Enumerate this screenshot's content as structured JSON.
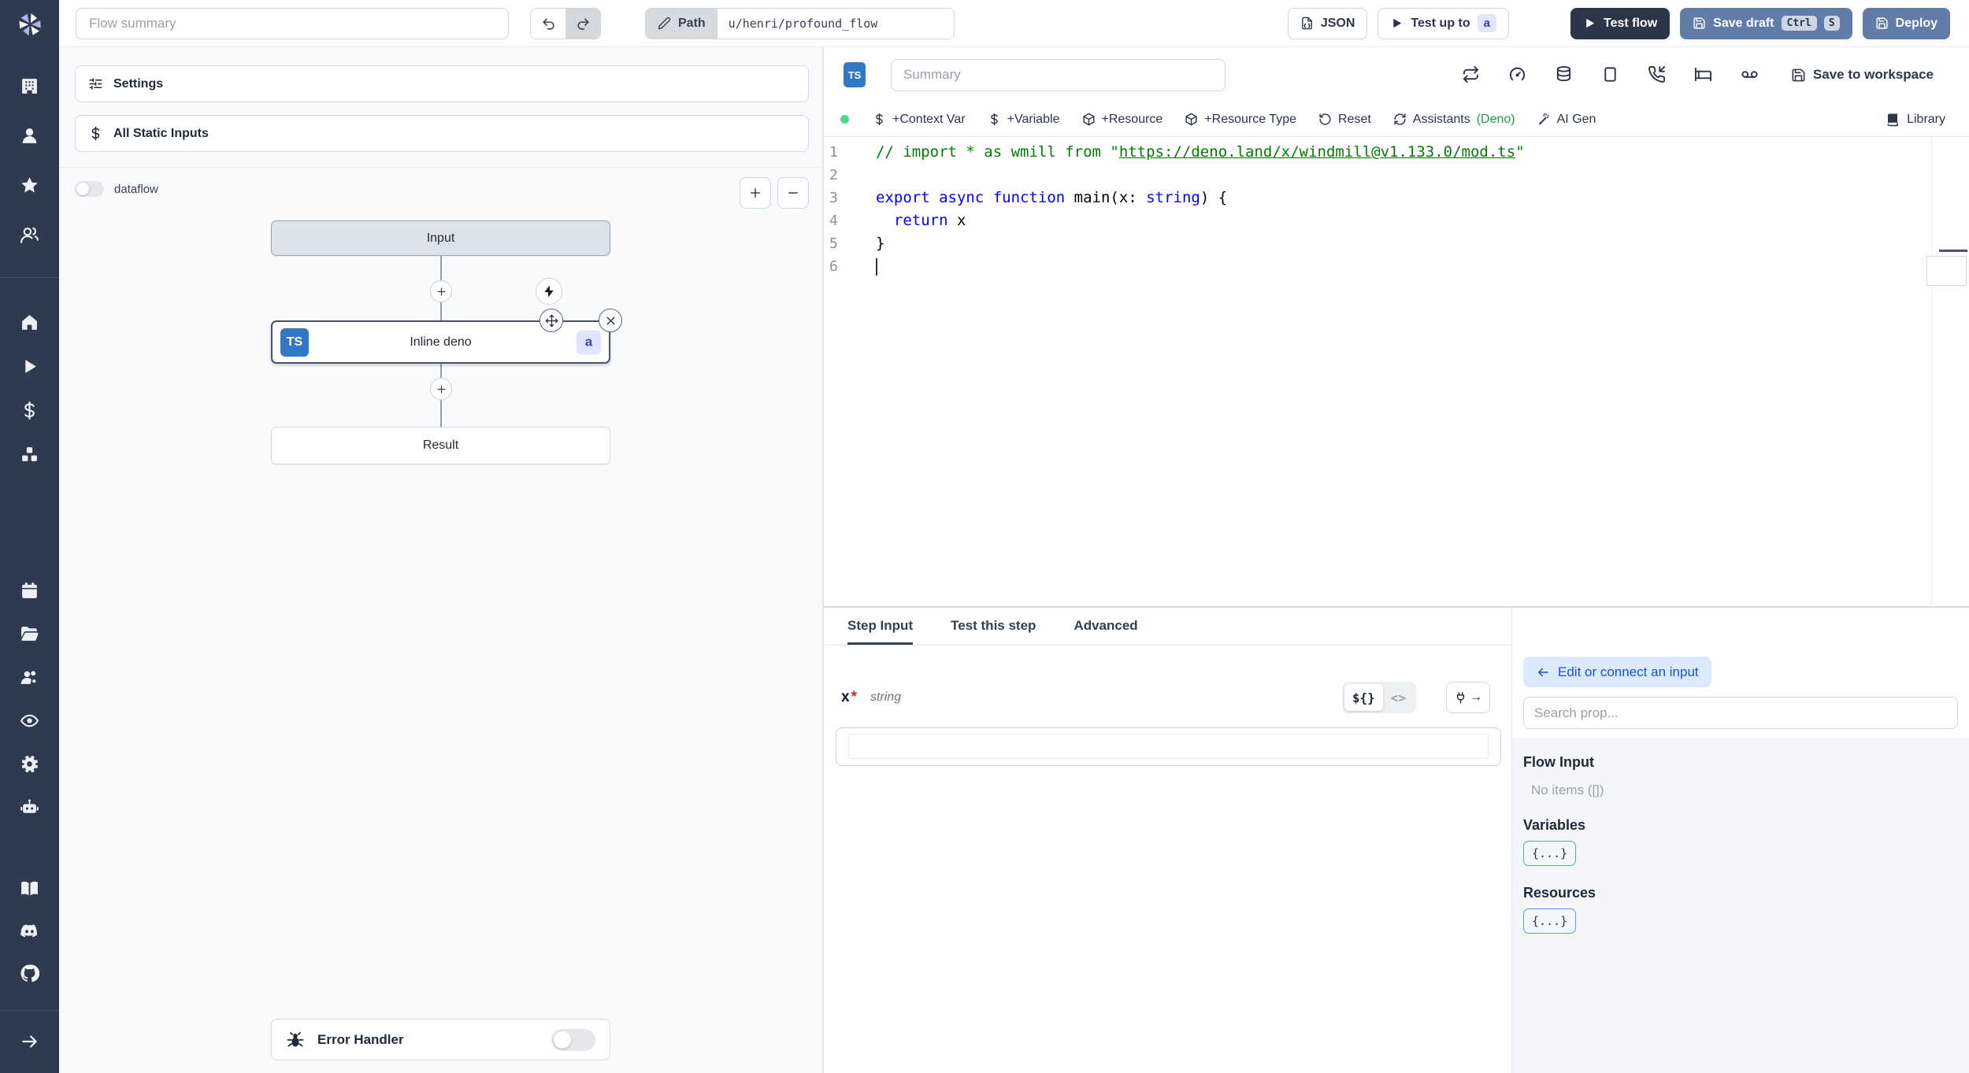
{
  "topbar": {
    "flow_summary_placeholder": "Flow summary",
    "path_label": "Path",
    "path_value": "u/henri/profound_flow",
    "json_button": "JSON",
    "test_up_to_label": "Test up to",
    "test_up_to_badge": "a",
    "test_flow_label": "Test flow",
    "save_draft_label": "Save draft",
    "save_draft_kbd": [
      "Ctrl",
      "S"
    ],
    "deploy_label": "Deploy"
  },
  "sidebar": {
    "groups": {
      "top": [
        "building",
        "user",
        "star",
        "users"
      ],
      "main": [
        "home",
        "play",
        "dollar",
        "boxes"
      ],
      "secondary": [
        "calendar",
        "folder-open",
        "users-cog",
        "eye",
        "settings",
        "bot"
      ],
      "footer": [
        "book-open",
        "discord",
        "github"
      ]
    },
    "expand_icon": "arrow-right"
  },
  "flow_panel": {
    "settings_label": "Settings",
    "static_inputs_label": "All Static Inputs",
    "dataflow_label": "dataflow",
    "zoom_in_label": "+",
    "zoom_out_label": "−",
    "nodes": {
      "input": "Input",
      "step": "Inline deno",
      "step_lang_badge": "TS",
      "step_id_badge": "a",
      "result": "Result"
    },
    "error_handler_label": "Error Handler"
  },
  "editor_panel": {
    "lang_badge": "TS",
    "summary_placeholder": "Summary",
    "header_icons": [
      "repeat",
      "gauge",
      "database",
      "square",
      "phone-incoming",
      "bed",
      "voicemail"
    ],
    "save_to_workspace_label": "Save to workspace",
    "toolbar": [
      {
        "icon": "dollar",
        "label": "+Context Var"
      },
      {
        "icon": "dollar",
        "label": "+Variable"
      },
      {
        "icon": "package",
        "label": "+Resource"
      },
      {
        "icon": "package",
        "label": "+Resource Type"
      },
      {
        "icon": "rotate-ccw",
        "label": "Reset"
      },
      {
        "icon": "refresh-cw",
        "label": "Assistants",
        "suffix": "(Deno)"
      },
      {
        "icon": "wand",
        "label": "AI Gen"
      }
    ],
    "library_label": "Library",
    "code": {
      "colors": {
        "comment": "#008000",
        "keyword": "#0000ff",
        "plain": "#000000"
      },
      "lines": [
        {
          "n": "1",
          "cursor": false,
          "segments": [
            {
              "text": "// import * as wmill from \"",
              "style": "comment"
            },
            {
              "text": "https://deno.land/x/windmill@v1.133.0/mod.ts",
              "style": "comment-link"
            },
            {
              "text": "\"",
              "style": "comment"
            }
          ]
        },
        {
          "n": "2",
          "cursor": false,
          "segments": []
        },
        {
          "n": "3",
          "cursor": false,
          "segments": [
            {
              "text": "export async function ",
              "style": "keyword"
            },
            {
              "text": "main(x: ",
              "style": "plain"
            },
            {
              "text": "string",
              "style": "keyword"
            },
            {
              "text": ") {",
              "style": "plain"
            }
          ]
        },
        {
          "n": "4",
          "cursor": false,
          "segments": [
            {
              "text": "  ",
              "style": "plain"
            },
            {
              "text": "return",
              "style": "keyword"
            },
            {
              "text": " x",
              "style": "plain"
            }
          ]
        },
        {
          "n": "5",
          "cursor": false,
          "segments": [
            {
              "text": "}",
              "style": "plain"
            }
          ]
        },
        {
          "n": "6",
          "cursor": true,
          "segments": []
        }
      ]
    }
  },
  "step_panel": {
    "tabs": [
      {
        "label": "Step Input",
        "active": true
      },
      {
        "label": "Test this step",
        "active": false
      },
      {
        "label": "Advanced",
        "active": false
      }
    ],
    "field": {
      "name": "x",
      "required_mark": "*",
      "type": "string",
      "value": ""
    },
    "editor_toggle": {
      "interpolate": "${}",
      "code": "<>"
    }
  },
  "prop_picker": {
    "back_button_label": "Edit or connect an input",
    "search_placeholder": "Search prop...",
    "sections": [
      {
        "title": "Flow Input",
        "empty": "No items ([])"
      },
      {
        "title": "Variables",
        "badge": "{...}"
      },
      {
        "title": "Resources",
        "badge": "{...}"
      }
    ]
  },
  "colors": {
    "sidebar_bg": "#2e3a4d",
    "primary_button": "#5f7da6",
    "dark_button": "#2b3648",
    "ts_badge": "#3178c6",
    "step_id_badge_bg": "#e0e5fb",
    "status_dot": "#4ade80",
    "deno_green": "#16a34a",
    "back_button_bg": "#dbeafe",
    "back_button_text": "#1d4ed8",
    "canvas_bg": "#f8fafc"
  }
}
